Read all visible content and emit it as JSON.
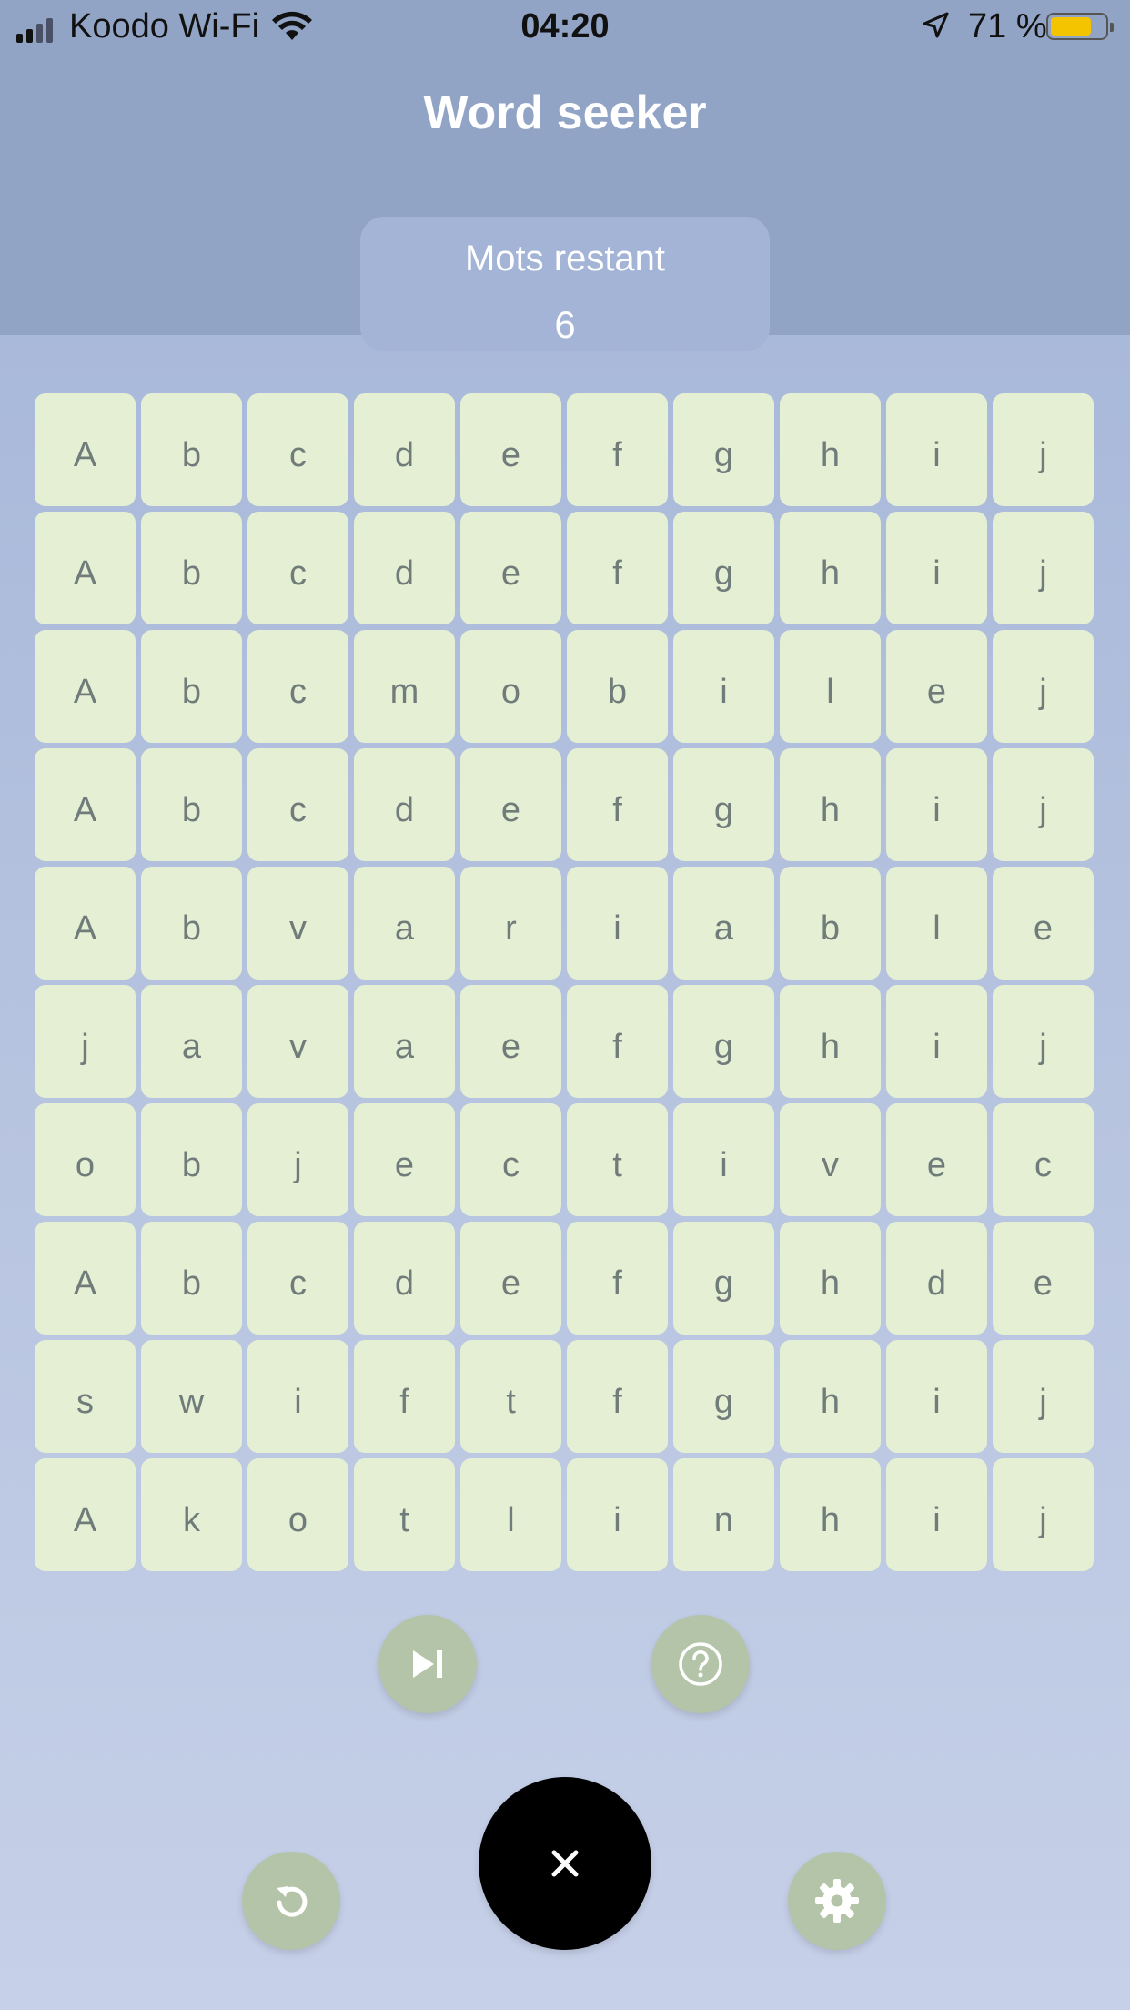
{
  "status_bar": {
    "carrier": "Koodo Wi-Fi",
    "time": "04:20",
    "battery_percent": "71 %"
  },
  "header": {
    "title": "Word seeker"
  },
  "counter": {
    "label": "Mots restant",
    "value": "6"
  },
  "grid": {
    "rows": [
      [
        "A",
        "b",
        "c",
        "d",
        "e",
        "f",
        "g",
        "h",
        "i",
        "j"
      ],
      [
        "A",
        "b",
        "c",
        "d",
        "e",
        "f",
        "g",
        "h",
        "i",
        "j"
      ],
      [
        "A",
        "b",
        "c",
        "m",
        "o",
        "b",
        "i",
        "l",
        "e",
        "j"
      ],
      [
        "A",
        "b",
        "c",
        "d",
        "e",
        "f",
        "g",
        "h",
        "i",
        "j"
      ],
      [
        "A",
        "b",
        "v",
        "a",
        "r",
        "i",
        "a",
        "b",
        "l",
        "e"
      ],
      [
        "j",
        "a",
        "v",
        "a",
        "e",
        "f",
        "g",
        "h",
        "i",
        "j"
      ],
      [
        "o",
        "b",
        "j",
        "e",
        "c",
        "t",
        "i",
        "v",
        "e",
        "c"
      ],
      [
        "A",
        "b",
        "c",
        "d",
        "e",
        "f",
        "g",
        "h",
        "d",
        "e"
      ],
      [
        "s",
        "w",
        "i",
        "f",
        "t",
        "f",
        "g",
        "h",
        "i",
        "j"
      ],
      [
        "A",
        "k",
        "o",
        "t",
        "l",
        "i",
        "n",
        "h",
        "i",
        "j"
      ]
    ]
  },
  "actions": {
    "skip_icon": "skip-next-icon",
    "hint_icon": "help-circle-icon",
    "restart_icon": "restart-icon",
    "close_icon": "close-icon",
    "settings_icon": "gear-icon"
  },
  "colors": {
    "header_bg": "#92a4c5",
    "cell_bg": "#e5efd4",
    "fab_bg": "#b3c4a8",
    "close_fab_bg": "#000000",
    "battery": "#f5c400"
  }
}
